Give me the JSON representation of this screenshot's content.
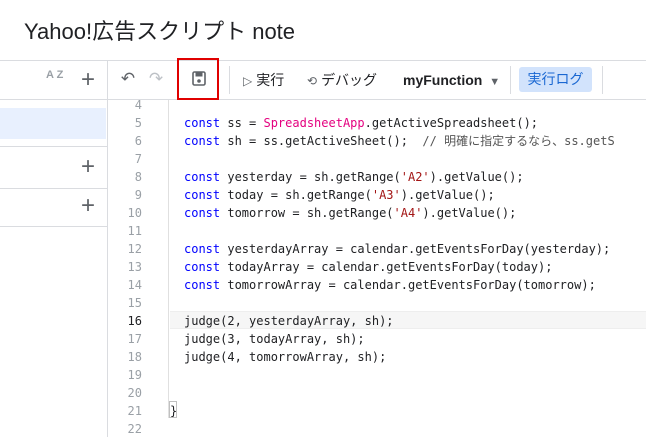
{
  "title": "Yahoo!広告スクリプト note",
  "sidebar": {
    "sort_icon": "A Z",
    "add_icon": "+"
  },
  "toolbar": {
    "undo_icon": "↶",
    "redo_icon": "↷",
    "run_label": "実行",
    "debug_label": "デバッグ",
    "function_name": "myFunction",
    "log_label": "実行ログ"
  },
  "editor": {
    "lines": [
      {
        "n": "4"
      },
      {
        "n": "5",
        "kw": "const",
        "rest1": " ss = ",
        "cls": "SpreadsheetApp",
        "rest2": ".getActiveSpreadsheet();"
      },
      {
        "n": "6",
        "kw": "const",
        "rest1": " sh = ss.getActiveSheet();  ",
        "cmt": "// 明確に指定するなら、ss.getS"
      },
      {
        "n": "7"
      },
      {
        "n": "8",
        "kw": "const",
        "rest1": " yesterday = sh.getRange(",
        "str": "'A2'",
        "rest2": ").getValue();"
      },
      {
        "n": "9",
        "kw": "const",
        "rest1": " today = sh.getRange(",
        "str": "'A3'",
        "rest2": ").getValue();"
      },
      {
        "n": "10",
        "kw": "const",
        "rest1": " tomorrow = sh.getRange(",
        "str": "'A4'",
        "rest2": ").getValue();"
      },
      {
        "n": "11"
      },
      {
        "n": "12",
        "kw": "const",
        "rest1": " yesterdayArray = calendar.getEventsForDay(yesterday);"
      },
      {
        "n": "13",
        "kw": "const",
        "rest1": " todayArray = calendar.getEventsForDay(today);"
      },
      {
        "n": "14",
        "kw": "const",
        "rest1": " tomorrowArray = calendar.getEventsForDay(tomorrow);"
      },
      {
        "n": "15"
      },
      {
        "n": "16",
        "rest1": "judge(2, yesterdayArray, sh);"
      },
      {
        "n": "17",
        "rest1": "judge(3, todayArray, sh);"
      },
      {
        "n": "18",
        "rest1": "judge(4, tomorrowArray, sh);"
      },
      {
        "n": "19"
      },
      {
        "n": "20"
      },
      {
        "n": "21",
        "rest1": "}"
      },
      {
        "n": "22"
      }
    ]
  }
}
